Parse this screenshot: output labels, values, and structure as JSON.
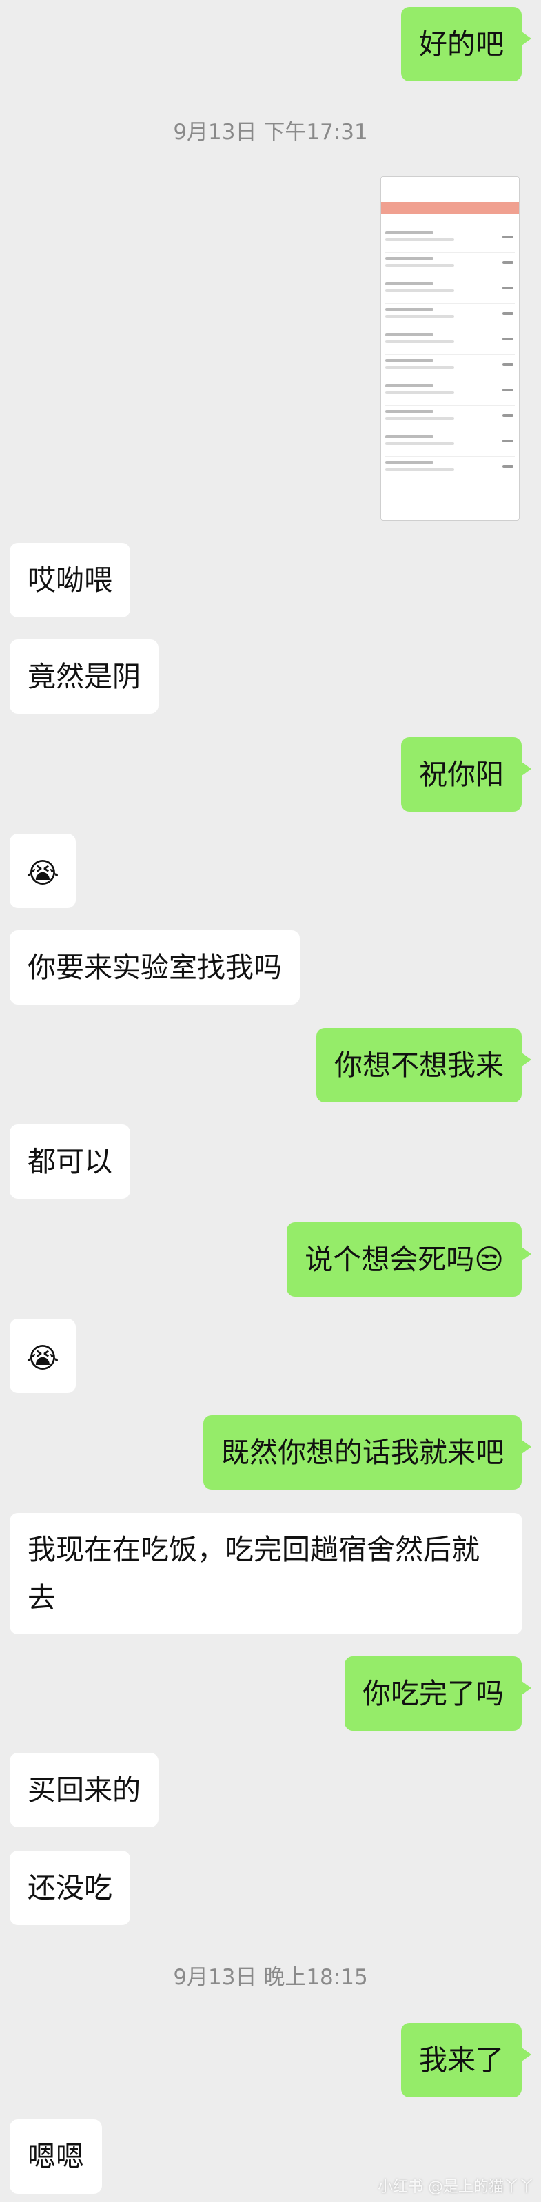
{
  "messages": [
    {
      "side": "right",
      "text": "好的吧"
    },
    {
      "type": "timestamp",
      "text": "9月13日 下午17:31"
    },
    {
      "side": "right",
      "type": "image"
    },
    {
      "side": "left",
      "text": "哎呦喂"
    },
    {
      "side": "left",
      "text": "竟然是阴"
    },
    {
      "side": "right",
      "text": "祝你阳"
    },
    {
      "side": "left",
      "type": "emoji",
      "emoji": "😭"
    },
    {
      "side": "left",
      "text": "你要来实验室找我吗"
    },
    {
      "side": "right",
      "text": "你想不想我来"
    },
    {
      "side": "left",
      "text": "都可以"
    },
    {
      "side": "right",
      "text": "说个想会死吗😒"
    },
    {
      "side": "left",
      "type": "emoji",
      "emoji": "😭"
    },
    {
      "side": "right",
      "text": "既然你想的话我就来吧"
    },
    {
      "side": "left",
      "text": "我现在在吃饭，吃完回趟宿舍然后就去"
    },
    {
      "side": "right",
      "text": "你吃完了吗"
    },
    {
      "side": "left",
      "text": "买回来的"
    },
    {
      "side": "left",
      "text": "还没吃"
    },
    {
      "type": "timestamp",
      "text": "9月13日 晚上18:15"
    },
    {
      "side": "right",
      "text": "我来了"
    },
    {
      "side": "left",
      "text": "嗯嗯"
    }
  ],
  "watermark": "小红书 @是上的猫丫丫",
  "colors": {
    "background": "#ededed",
    "sent_bubble": "#95ec69",
    "received_bubble": "#ffffff",
    "timestamp": "#8a8a8a"
  }
}
